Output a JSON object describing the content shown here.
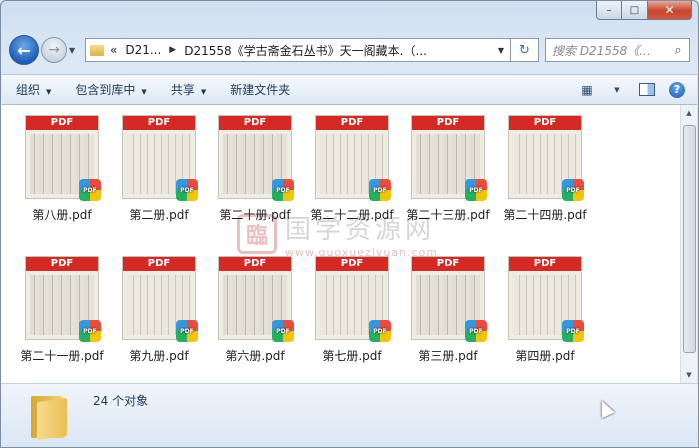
{
  "window": {
    "caption_buttons": {
      "minimize": "–",
      "maximize": "□",
      "close": "✕"
    }
  },
  "address": {
    "back_glyph": "←",
    "forward_glyph": "→",
    "prefix": "«",
    "crumb1": "D21...",
    "crumb2": "D21558《学古斋金石丛书》天一阁藏本.（...",
    "refresh_glyph": "↻",
    "search_placeholder": "搜索 D21558《...",
    "search_glyph": "⌕"
  },
  "toolbar": {
    "organize": "组织",
    "include_library": "包含到库中",
    "share": "共享",
    "new_folder": "新建文件夹",
    "help": "?"
  },
  "files": [
    {
      "name": "第八册.pdf"
    },
    {
      "name": "第二册.pdf"
    },
    {
      "name": "第二十册.pdf"
    },
    {
      "name": "第二十二册.pdf"
    },
    {
      "name": "第二十三册.pdf"
    },
    {
      "name": "第二十四册.pdf"
    },
    {
      "name": "第二十一册.pdf"
    },
    {
      "name": "第九册.pdf"
    },
    {
      "name": "第六册.pdf"
    },
    {
      "name": "第七册.pdf"
    },
    {
      "name": "第三册.pdf"
    },
    {
      "name": "第四册.pdf"
    }
  ],
  "thumb_label": "PDF",
  "badge_label": "PDF",
  "watermark": {
    "seal": "臨",
    "text": "国学资源网",
    "url": "www.guoxueziyuan.com"
  },
  "status": {
    "count": "24 个对象"
  },
  "colors": {
    "pdf_red": "#d42a26",
    "toolbar_text": "#1e395b"
  }
}
